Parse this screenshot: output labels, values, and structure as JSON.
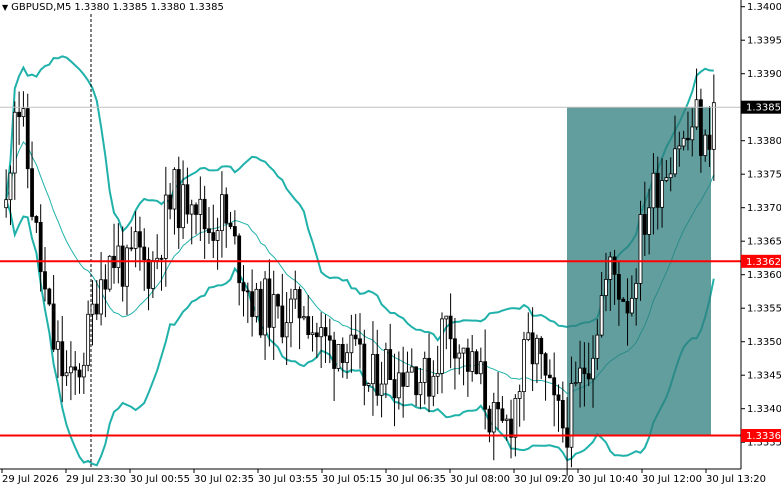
{
  "header": {
    "dropdown_glyph": "▼",
    "symbol_timeframe": "GBPUSD,M5",
    "ohlc": "1.3380 1.3385 1.3380 1.3385"
  },
  "price_axis": {
    "ticks": [
      "1.3400",
      "1.3395",
      "1.3390",
      "1.3380",
      "1.3375",
      "1.3370",
      "1.3365",
      "1.3360",
      "1.3355",
      "1.3350",
      "1.3345",
      "1.3340",
      "1.3335"
    ],
    "current_price_tag": "1.3385",
    "level_tags": [
      "1.3362",
      "1.3336"
    ]
  },
  "time_axis": {
    "ticks": [
      "29 Jul 2026",
      "29 Jul 23:30",
      "30 Jul 00:55",
      "30 Jul 02:35",
      "30 Jul 03:55",
      "30 Jul 05:15",
      "30 Jul 06:35",
      "30 Jul 08:00",
      "30 Jul 09:20",
      "30 Jul 10:40",
      "30 Jul 12:00",
      "30 Jul 13:20"
    ]
  },
  "colors": {
    "bollinger": "#20b2aa",
    "level_line": "#ff0000",
    "zone_fill": "#2e7d7d",
    "tag_current": "#000000",
    "tag_level": "#ff0000"
  },
  "chart_data": {
    "type": "candlestick",
    "title": "GBPUSD,M5",
    "ylim": [
      1.3331,
      1.3401
    ],
    "horizontal_levels": [
      1.3362,
      1.3336
    ],
    "last_price": 1.3385,
    "highlight_zone": {
      "price_from": 1.3336,
      "price_to": 1.3385
    },
    "close_path": [
      1.337,
      1.3388,
      1.338,
      1.3368,
      1.3358,
      1.335,
      1.3346,
      1.3343,
      1.3347,
      1.3352,
      1.336,
      1.3362,
      1.3363,
      1.336,
      1.3364,
      1.3361,
      1.3362,
      1.3368,
      1.3372,
      1.337,
      1.3374,
      1.3368,
      1.3367,
      1.337,
      1.3366,
      1.3362,
      1.3358,
      1.3354,
      1.3356,
      1.3353,
      1.3355,
      1.3354,
      1.3356,
      1.3352,
      1.335,
      1.3349,
      1.3351,
      1.3348,
      1.3346,
      1.3343,
      1.3346,
      1.3347,
      1.3345,
      1.3347,
      1.3346,
      1.3344,
      1.3346,
      1.3353,
      1.3352,
      1.3348,
      1.3346,
      1.3344,
      1.3339,
      1.3336,
      1.3338,
      1.3343,
      1.3349,
      1.3348,
      1.3343,
      1.3339,
      1.3337,
      1.3341,
      1.3346,
      1.335,
      1.3357,
      1.3361,
      1.3358,
      1.3356,
      1.3365,
      1.3371,
      1.3374,
      1.3377,
      1.3381,
      1.3379,
      1.3384,
      1.3378,
      1.3385
    ]
  }
}
